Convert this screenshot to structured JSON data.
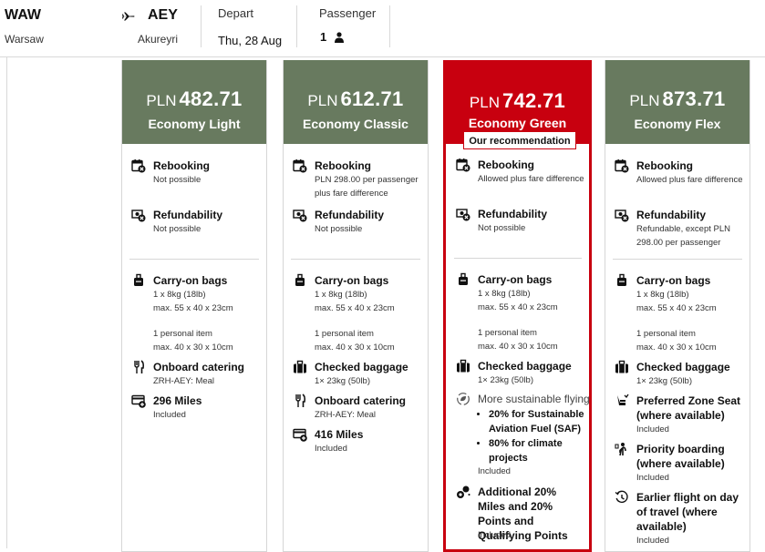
{
  "search": {
    "origin": {
      "code": "WAW",
      "city": "Warsaw"
    },
    "destination": {
      "code": "AEY",
      "city": "Akureyri"
    },
    "depart": {
      "label": "Depart",
      "value": "Thu, 28 Aug"
    },
    "passenger": {
      "label": "Passenger",
      "count": "1"
    }
  },
  "fares": [
    {
      "currency": "PLN",
      "amount": "482.71",
      "name": "Economy Light",
      "rebooking": {
        "title": "Rebooking",
        "detail": "Not possible"
      },
      "refund": {
        "title": "Refundability",
        "detail": "Not possible"
      },
      "carry_on": {
        "title": "Carry-on bags",
        "line1": "1 x 8kg (18lb)",
        "line2": "max. 55 x 40 x 23cm",
        "line3": "1 personal item",
        "line4": "max. 40 x 30 x 10cm"
      },
      "catering": {
        "title": "Onboard catering",
        "detail": "ZRH-AEY: Meal"
      },
      "miles": {
        "title": "296 Miles",
        "detail": "Included"
      }
    },
    {
      "currency": "PLN",
      "amount": "612.71",
      "name": "Economy Classic",
      "rebooking": {
        "title": "Rebooking",
        "line1": "PLN 298.00 per passenger",
        "line2": "plus fare difference"
      },
      "refund": {
        "title": "Refundability",
        "detail": "Not possible"
      },
      "carry_on": {
        "title": "Carry-on bags",
        "line1": "1 x 8kg (18lb)",
        "line2": "max. 55 x 40 x 23cm",
        "line3": "1 personal item",
        "line4": "max. 40 x 30 x 10cm"
      },
      "checked": {
        "title": "Checked baggage",
        "detail": "1× 23kg (50lb)"
      },
      "catering": {
        "title": "Onboard catering",
        "detail": "ZRH-AEY: Meal"
      },
      "miles": {
        "title": "416 Miles",
        "detail": "Included"
      }
    },
    {
      "currency": "PLN",
      "amount": "742.71",
      "name": "Economy Green",
      "badge": "Our recommendation",
      "rebooking": {
        "title": "Rebooking",
        "detail": "Allowed plus fare difference"
      },
      "refund": {
        "title": "Refundability",
        "detail": "Not possible"
      },
      "carry_on": {
        "title": "Carry-on bags",
        "line1": "1 x 8kg (18lb)",
        "line2": "max. 55 x 40 x 23cm",
        "line3": "1 personal item",
        "line4": "max. 40 x 30 x 10cm"
      },
      "checked": {
        "title": "Checked baggage",
        "detail": "1× 23kg (50lb)"
      },
      "sustainable": {
        "title": "More sustainable flying",
        "bullets": [
          "20% for Sustainable Aviation Fuel (SAF)",
          "80% for climate projects"
        ],
        "detail": "Included"
      },
      "bonus": {
        "title": "Additional 20% Miles and 20% Points and Qualifying Points",
        "detail": "Included"
      }
    },
    {
      "currency": "PLN",
      "amount": "873.71",
      "name": "Economy Flex",
      "rebooking": {
        "title": "Rebooking",
        "detail": "Allowed plus fare difference"
      },
      "refund": {
        "title": "Refundability",
        "line1": "Refundable, except PLN",
        "line2": "298.00 per passenger"
      },
      "carry_on": {
        "title": "Carry-on bags",
        "line1": "1 x 8kg (18lb)",
        "line2": "max. 55 x 40 x 23cm",
        "line3": "1 personal item",
        "line4": "max. 40 x 30 x 10cm"
      },
      "checked": {
        "title": "Checked baggage",
        "detail": "1× 23kg (50lb)"
      },
      "seat": {
        "title": "Preferred Zone Seat (where available)",
        "detail": "Included"
      },
      "priority": {
        "title": "Priority boarding (where available)",
        "detail": "Included"
      },
      "earlier": {
        "title": "Earlier flight on day of travel (where available)",
        "detail": "Included"
      }
    }
  ],
  "colors": {
    "fare_header": "#687a5f",
    "recommended": "#c8000f"
  },
  "icons": [
    "plane-icon",
    "person-icon",
    "calendar-x-icon",
    "money-x-icon",
    "carry-on-bag-icon",
    "cutlery-icon",
    "miles-card-icon",
    "suitcase-icon",
    "leaf-cycle-icon",
    "coins-icon",
    "seat-icon",
    "priority-boarding-icon",
    "clock-back-icon"
  ]
}
